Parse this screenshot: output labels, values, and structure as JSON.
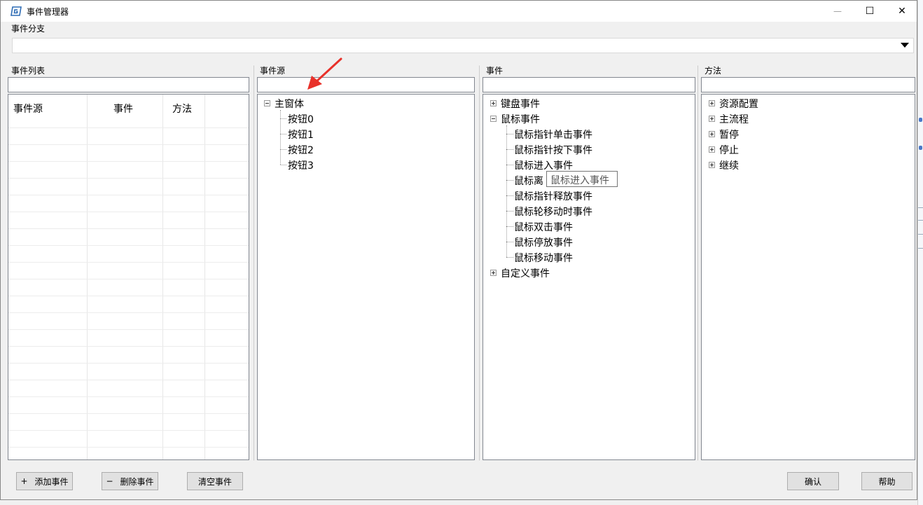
{
  "window": {
    "title": "事件管理器",
    "controls": {
      "minimize": "—",
      "maximize": "☐",
      "close": "✕"
    }
  },
  "branch": {
    "label": "事件分支",
    "value": ""
  },
  "event_list": {
    "label": "事件列表",
    "search_value": "",
    "columns": [
      "事件源",
      "事件",
      "方法"
    ]
  },
  "event_source": {
    "label": "事件源",
    "search_value": "",
    "root": "主窗体",
    "children": [
      "按钮0",
      "按钮1",
      "按钮2",
      "按钮3"
    ]
  },
  "events": {
    "label": "事件",
    "search_value": "",
    "groups": [
      {
        "label": "键盘事件",
        "expanded": false,
        "children": []
      },
      {
        "label": "鼠标事件",
        "expanded": true,
        "children": [
          "鼠标指针单击事件",
          "鼠标指针按下事件",
          "鼠标进入事件",
          "鼠标离",
          "鼠标指针释放事件",
          "鼠标轮移动时事件",
          "鼠标双击事件",
          "鼠标停放事件",
          "鼠标移动事件"
        ]
      },
      {
        "label": "自定义事件",
        "expanded": false,
        "children": []
      }
    ],
    "tooltip": "鼠标进入事件"
  },
  "methods": {
    "label": "方法",
    "search_value": "",
    "items": [
      "资源配置",
      "主流程",
      "暂停",
      "停止",
      "继续"
    ]
  },
  "buttons": {
    "add": {
      "symbol": "+",
      "label": "添加事件"
    },
    "delete": {
      "symbol": "−",
      "label": "删除事件"
    },
    "clear": {
      "label": "清空事件"
    },
    "confirm": {
      "label": "确认"
    },
    "help": {
      "label": "帮助"
    }
  },
  "colors": {
    "annotation_arrow": "#e8312a",
    "icon_blue": "#2f6db5"
  }
}
